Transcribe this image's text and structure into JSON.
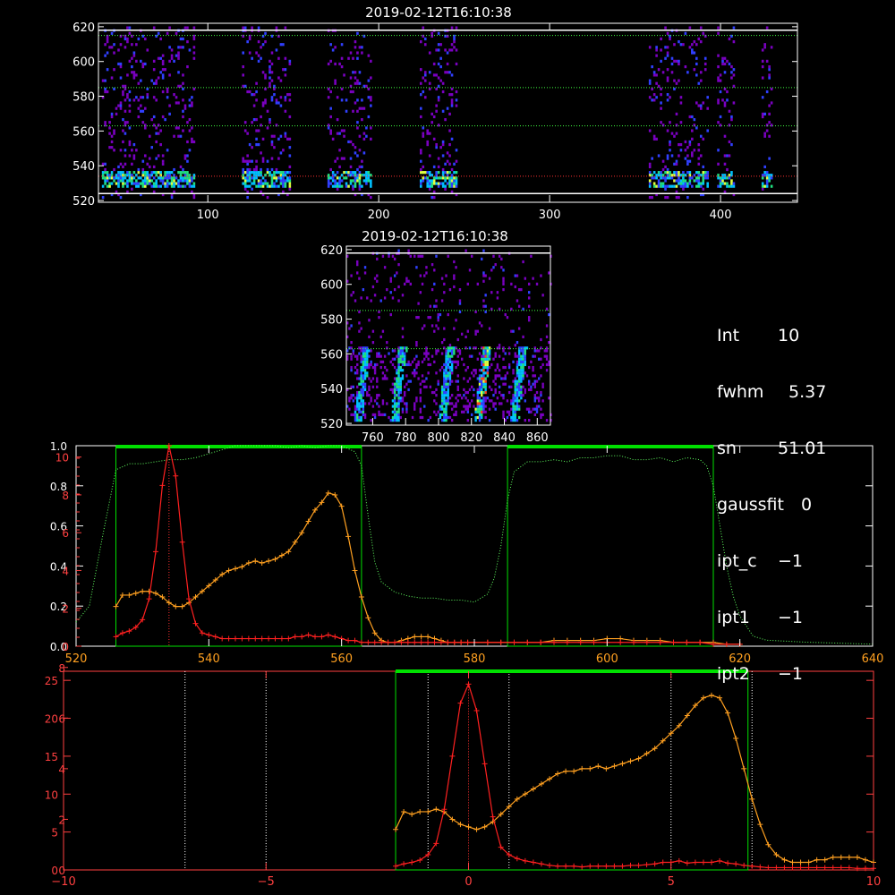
{
  "colors": {
    "background": "#000000",
    "axes_white": "#ffffff",
    "axes_red": "#ff4040",
    "red_series": "#ff2020",
    "orange_series": "#ffa020",
    "green": "#00e000",
    "green_dotted": "#40ff40",
    "heat_low": "#5a008a",
    "heat_high": "#ffff40"
  },
  "panel_top": {
    "title": "2019-02-12T16:10:38",
    "xticks": [
      "100",
      "200",
      "300",
      "400"
    ],
    "yticks": [
      "520",
      "540",
      "560",
      "580",
      "600",
      "620"
    ],
    "xlim": [
      36,
      445
    ],
    "ylim": [
      519,
      622
    ],
    "dotted_levels": [
      615,
      585,
      563
    ],
    "red_dotted_level": 534,
    "white_lines": [
      618,
      524
    ],
    "bands": [
      [
        38,
        92
      ],
      [
        120,
        148
      ],
      [
        170,
        196
      ],
      [
        224,
        246
      ],
      [
        358,
        392
      ],
      [
        398,
        408
      ],
      [
        424,
        430
      ]
    ]
  },
  "panel_mid": {
    "title": "2019-02-12T16:10:38",
    "xticks": [
      "760",
      "780",
      "800",
      "820",
      "840",
      "860"
    ],
    "yticks": [
      "520",
      "540",
      "560",
      "580",
      "600",
      "620"
    ],
    "xlim": [
      744,
      868
    ],
    "ylim": [
      519,
      622
    ],
    "white_line_top": 618,
    "dotted_levels": [
      585,
      563
    ],
    "streak_columns": [
      753,
      775,
      804,
      826,
      848
    ]
  },
  "info": [
    {
      "key": "Int",
      "value": "10"
    },
    {
      "key": "fwhm",
      "value": "5.37"
    },
    {
      "key": "sn",
      "value": "51.01"
    },
    {
      "key": "gaussfit",
      "value": "0"
    },
    {
      "key": "ipt_c",
      "value": "−1"
    },
    {
      "key": "ipt1",
      "value": "−1"
    },
    {
      "key": "ipt2",
      "value": "−1"
    }
  ],
  "panel_spec": {
    "xticks": [
      "520",
      "540",
      "560",
      "580",
      "600",
      "620",
      "640"
    ],
    "yticks_white": [
      "0.0",
      "0.2",
      "0.4",
      "0.6",
      "0.8",
      "1.0"
    ],
    "yticks_red": [
      "0",
      "2",
      "4",
      "6",
      "8",
      "10"
    ],
    "green_boxes": [
      [
        526,
        563
      ],
      [
        585,
        616
      ]
    ]
  },
  "panel_vel": {
    "xticks": [
      "−10",
      "−5",
      "0",
      "5",
      "10"
    ],
    "yticks_left": [
      "0",
      "5",
      "10",
      "15",
      "20",
      "25"
    ],
    "yticks_inner": [
      "0",
      "2",
      "4",
      "6",
      "8"
    ],
    "green_box": [
      -1.8,
      6.9
    ],
    "dotted_white": [
      -7,
      -5,
      -1,
      1,
      5,
      7
    ]
  },
  "chart_data": [
    {
      "type": "heatmap",
      "title": "2019-02-12T16:10:38",
      "xlim": [
        36,
        445
      ],
      "ylim": [
        519,
        622
      ]
    },
    {
      "type": "heatmap",
      "title": "2019-02-12T16:10:38",
      "xlim": [
        744,
        868
      ],
      "ylim": [
        519,
        622
      ]
    },
    {
      "type": "line",
      "xlim": [
        520,
        640
      ],
      "series": [
        {
          "x": [
            526,
            527,
            528,
            529,
            530,
            531,
            532,
            533,
            534,
            535,
            536,
            537,
            538,
            539,
            540,
            541,
            542,
            543,
            544,
            545,
            546,
            547,
            548,
            549,
            550,
            551,
            552,
            553,
            554,
            555,
            556,
            557,
            558,
            559,
            560,
            561,
            562,
            563,
            564,
            565,
            566,
            567,
            568,
            569,
            570,
            571,
            572,
            573,
            574,
            575,
            576,
            577,
            578,
            579,
            580,
            582,
            584,
            586,
            588,
            590,
            592,
            594,
            596,
            598,
            600,
            602,
            604,
            606,
            608,
            610,
            612,
            614,
            616,
            618,
            620
          ],
          "y": [
            0.5,
            0.7,
            0.8,
            1.0,
            1.4,
            2.5,
            5,
            8.5,
            10.6,
            9,
            5.5,
            2.5,
            1.2,
            0.7,
            0.6,
            0.5,
            0.4,
            0.4,
            0.4,
            0.4,
            0.4,
            0.4,
            0.4,
            0.4,
            0.4,
            0.4,
            0.4,
            0.5,
            0.5,
            0.6,
            0.5,
            0.5,
            0.6,
            0.5,
            0.4,
            0.3,
            0.3,
            0.2,
            0.2,
            0.2,
            0.2,
            0.2,
            0.2,
            0.2,
            0.2,
            0.2,
            0.2,
            0.2,
            0.2,
            0.2,
            0.2,
            0.2,
            0.2,
            0.2,
            0.2,
            0.2,
            0.2,
            0.2,
            0.2,
            0.2,
            0.2,
            0.2,
            0.2,
            0.2,
            0.2,
            0.2,
            0.2,
            0.2,
            0.2,
            0.2,
            0.2,
            0.2,
            0.1,
            0.1,
            0.1
          ]
        },
        {
          "x": [
            526,
            527,
            528,
            529,
            530,
            531,
            532,
            533,
            534,
            535,
            536,
            537,
            538,
            539,
            540,
            541,
            542,
            543,
            544,
            545,
            546,
            547,
            548,
            549,
            550,
            551,
            552,
            553,
            554,
            555,
            556,
            557,
            558,
            559,
            560,
            561,
            562,
            563,
            564,
            565,
            566,
            567,
            568,
            569,
            570,
            571,
            572,
            573,
            574,
            575,
            576,
            577,
            578,
            579,
            580,
            582,
            584,
            586,
            588,
            590,
            592,
            594,
            596,
            598,
            600,
            602,
            604,
            606,
            608,
            610,
            612,
            614,
            616,
            618,
            620
          ],
          "y": [
            2.1,
            2.7,
            2.7,
            2.8,
            2.9,
            2.9,
            2.8,
            2.6,
            2.3,
            2.1,
            2.1,
            2.3,
            2.6,
            2.9,
            3.2,
            3.5,
            3.8,
            4.0,
            4.1,
            4.2,
            4.4,
            4.5,
            4.4,
            4.5,
            4.6,
            4.8,
            5.0,
            5.5,
            6.0,
            6.6,
            7.2,
            7.6,
            8.1,
            8.0,
            7.4,
            5.8,
            4.0,
            2.6,
            1.5,
            0.7,
            0.3,
            0.2,
            0.2,
            0.3,
            0.4,
            0.5,
            0.5,
            0.5,
            0.4,
            0.3,
            0.2,
            0.2,
            0.2,
            0.2,
            0.2,
            0.2,
            0.2,
            0.2,
            0.2,
            0.2,
            0.3,
            0.3,
            0.3,
            0.3,
            0.4,
            0.4,
            0.3,
            0.3,
            0.3,
            0.2,
            0.2,
            0.2,
            0.2,
            0.1,
            0.1
          ]
        },
        {
          "x": [
            520,
            522,
            524,
            526,
            528,
            530,
            532,
            534,
            536,
            538,
            540,
            542,
            544,
            546,
            548,
            550,
            552,
            554,
            556,
            558,
            560,
            562,
            563,
            564,
            565,
            566,
            568,
            570,
            572,
            574,
            576,
            578,
            580,
            582,
            583,
            584,
            585,
            586,
            588,
            590,
            592,
            594,
            596,
            598,
            600,
            602,
            604,
            606,
            608,
            610,
            612,
            614,
            615,
            616,
            617,
            618,
            619,
            620,
            622,
            624,
            630,
            640
          ],
          "y": [
            0.12,
            0.2,
            0.55,
            0.88,
            0.91,
            0.91,
            0.92,
            0.93,
            0.93,
            0.94,
            0.96,
            0.98,
            1.0,
            1.0,
            1.0,
            1.0,
            0.99,
            1.0,
            0.99,
            1.0,
            1.0,
            0.97,
            0.9,
            0.65,
            0.42,
            0.32,
            0.27,
            0.25,
            0.24,
            0.24,
            0.23,
            0.23,
            0.22,
            0.26,
            0.34,
            0.5,
            0.73,
            0.87,
            0.92,
            0.92,
            0.93,
            0.92,
            0.94,
            0.94,
            0.95,
            0.95,
            0.93,
            0.93,
            0.94,
            0.92,
            0.94,
            0.93,
            0.9,
            0.8,
            0.6,
            0.4,
            0.25,
            0.15,
            0.05,
            0.03,
            0.02,
            0.01
          ]
        }
      ]
    },
    {
      "type": "line",
      "xlim": [
        -10,
        10
      ],
      "series": [
        {
          "x": [
            -1.8,
            -1.6,
            -1.4,
            -1.2,
            -1.0,
            -0.8,
            -0.6,
            -0.4,
            -0.2,
            0.0,
            0.2,
            0.4,
            0.6,
            0.8,
            1.0,
            1.2,
            1.4,
            1.6,
            1.8,
            2.0,
            2.2,
            2.4,
            2.6,
            2.8,
            3.0,
            3.2,
            3.4,
            3.6,
            3.8,
            4.0,
            4.2,
            4.4,
            4.6,
            4.8,
            5.0,
            5.2,
            5.4,
            5.6,
            5.8,
            6.0,
            6.2,
            6.4,
            6.6,
            6.8,
            7.0,
            7.2,
            7.4,
            7.6,
            7.8,
            8.0,
            8.2,
            8.4,
            8.6,
            8.8,
            9.0,
            9.2,
            9.4,
            9.6,
            9.8,
            10.0
          ],
          "y": [
            0.5,
            0.8,
            1.0,
            1.3,
            2,
            3.5,
            8,
            15,
            22,
            24.5,
            21,
            14,
            7,
            3,
            2,
            1.5,
            1.2,
            1,
            0.8,
            0.6,
            0.5,
            0.5,
            0.5,
            0.4,
            0.5,
            0.5,
            0.5,
            0.5,
            0.5,
            0.6,
            0.6,
            0.7,
            0.8,
            1.0,
            1.0,
            1.2,
            0.9,
            1.0,
            1.0,
            1.0,
            1.2,
            0.9,
            0.8,
            0.6,
            0.5,
            0.4,
            0.3,
            0.3,
            0.3,
            0.3,
            0.3,
            0.3,
            0.3,
            0.3,
            0.3,
            0.3,
            0.3,
            0.2,
            0.2,
            0.2
          ]
        },
        {
          "x": [
            -1.8,
            -1.6,
            -1.4,
            -1.2,
            -1.0,
            -0.8,
            -0.6,
            -0.4,
            -0.2,
            0.0,
            0.2,
            0.4,
            0.6,
            0.8,
            1.0,
            1.2,
            1.4,
            1.6,
            1.8,
            2.0,
            2.2,
            2.4,
            2.6,
            2.8,
            3.0,
            3.2,
            3.4,
            3.6,
            3.8,
            4.0,
            4.2,
            4.4,
            4.6,
            4.8,
            5.0,
            5.2,
            5.4,
            5.6,
            5.8,
            6.0,
            6.2,
            6.4,
            6.6,
            6.8,
            7.0,
            7.2,
            7.4,
            7.6,
            7.8,
            8.0,
            8.2,
            8.4,
            8.6,
            8.8,
            9.0,
            9.2,
            9.4,
            9.6,
            9.8,
            10.0
          ],
          "y": [
            1.6,
            2.3,
            2.2,
            2.3,
            2.3,
            2.4,
            2.3,
            2.0,
            1.8,
            1.7,
            1.6,
            1.7,
            1.9,
            2.2,
            2.5,
            2.8,
            3.0,
            3.2,
            3.4,
            3.6,
            3.8,
            3.9,
            3.9,
            4.0,
            4.0,
            4.1,
            4.0,
            4.1,
            4.2,
            4.3,
            4.4,
            4.6,
            4.8,
            5.1,
            5.4,
            5.7,
            6.1,
            6.5,
            6.8,
            6.9,
            6.8,
            6.2,
            5.2,
            4.0,
            2.8,
            1.8,
            1.0,
            0.6,
            0.4,
            0.3,
            0.3,
            0.3,
            0.4,
            0.4,
            0.5,
            0.5,
            0.5,
            0.5,
            0.4,
            0.3
          ]
        }
      ]
    }
  ]
}
